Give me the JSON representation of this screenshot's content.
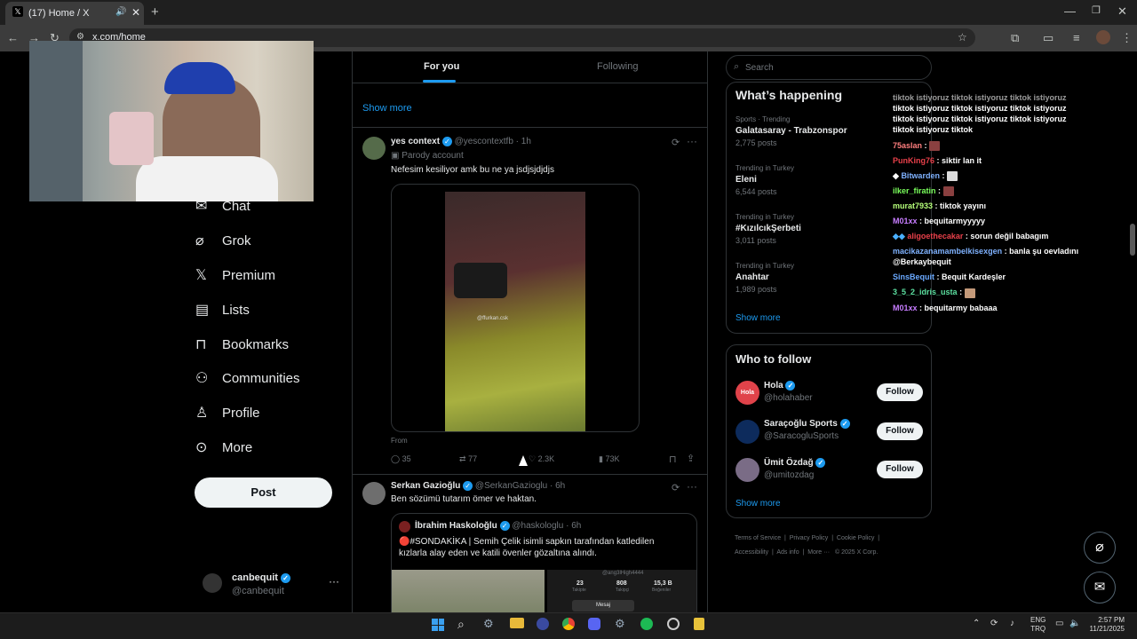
{
  "browser": {
    "tab_title": "(17) Home / X",
    "url": "x.com/home"
  },
  "nav": {
    "items": [
      {
        "label": "Chat",
        "icon": "chat-icon"
      },
      {
        "label": "Grok",
        "icon": "grok-icon"
      },
      {
        "label": "Premium",
        "icon": "x-logo-icon"
      },
      {
        "label": "Lists",
        "icon": "list-icon"
      },
      {
        "label": "Bookmarks",
        "icon": "bookmark-icon"
      },
      {
        "label": "Communities",
        "icon": "communities-icon"
      },
      {
        "label": "Profile",
        "icon": "profile-icon"
      },
      {
        "label": "More",
        "icon": "more-circle-icon"
      }
    ],
    "post_label": "Post",
    "account_name": "canbequit",
    "account_handle": "@canbequit"
  },
  "feed": {
    "tabs": [
      "For you",
      "Following"
    ],
    "show_more": "Show more",
    "post1": {
      "name": "yes context",
      "handle": "@yescontextfb",
      "time": "· 1h",
      "parody": "Parody account",
      "text": "Nefesim kesiliyor amk bu ne ya jsdjsjdjdjs",
      "watermark": "@ffurkan.csk",
      "from": "From",
      "replies": "35",
      "reposts": "77",
      "likes": "2.3K",
      "views": "73K"
    },
    "post2": {
      "name": "Serkan Gazioğlu",
      "handle": "@SerkanGazioglu",
      "time": "· 6h",
      "text": "Ben sözümü tutarım ömer ve haktan.",
      "quote": {
        "name": "İbrahim Haskoloğlu",
        "handle": "@haskologlu",
        "time": "· 6h",
        "text": "🔴#SONDAKİKA | Semih Çelik isimli sapkın tarafından katledilen kızlarla alay eden ve katili övenler gözaltına alındı.",
        "profile_handle": "@ang3lHigh4444",
        "stat1_val": "23",
        "stat1_label": "Takipte",
        "stat2_val": "808",
        "stat2_label": "Takipçi",
        "stat3_val": "15,3 B",
        "stat3_label": "Beğeniler",
        "btn_label": "Mesaj"
      }
    }
  },
  "search": {
    "placeholder": "Search"
  },
  "trends": {
    "title": "What’s happening",
    "items": [
      {
        "context": "Sports · Trending",
        "name": "Galatasaray - Trabzonspor",
        "count": "2,775 posts"
      },
      {
        "context": "Trending in Turkey",
        "name": "Eleni",
        "count": "6,544 posts"
      },
      {
        "context": "Trending in Turkey",
        "name": "#KızılcıkŞerbeti",
        "count": "3,011 posts"
      },
      {
        "context": "Trending in Turkey",
        "name": "Anahtar",
        "count": "1,989 posts"
      }
    ],
    "show_more": "Show more"
  },
  "who_to_follow": {
    "title": "Who to follow",
    "items": [
      {
        "name": "Hola",
        "handle": "@holahaber",
        "avatar_text": "Hola",
        "avatar_color": "#e0434a"
      },
      {
        "name": "Saraçoğlu Sports",
        "handle": "@SaracogluSports",
        "avatar_text": "",
        "avatar_color": "#0d2b5c"
      },
      {
        "name": "Ümit Özdağ",
        "handle": "@umitozdag",
        "avatar_text": "",
        "avatar_color": "#7a6c86"
      }
    ],
    "follow_label": "Follow",
    "show_more": "Show more"
  },
  "footer": {
    "row1": [
      "Terms of Service",
      "Privacy Policy",
      "Cookie Policy"
    ],
    "row2": [
      "Accessibility",
      "Ads info",
      "More ···",
      "© 2025 X Corp."
    ]
  },
  "chat": {
    "spam_lines": [
      "tiktok istiyoruz tiktok istiyoruz tiktok istiyoruz",
      "tiktok istiyoruz tiktok istiyoruz tiktok istiyoruz",
      "tiktok istiyoruz tiktok istiyoruz tiktok istiyoruz",
      "tiktok istiyoruz tiktok"
    ],
    "messages": [
      {
        "user": "75aslan",
        "color": "#ff7f7f",
        "text": ""
      },
      {
        "user": "PunKing76",
        "color": "#e8404a",
        "text": "siktir lan it"
      },
      {
        "user": "Bitwarden",
        "color": "#7fb2ff",
        "text": ""
      },
      {
        "user": "ilker_firatin",
        "color": "#7aff5c",
        "text": ""
      },
      {
        "user": "murat7933",
        "color": "#b6ff7a",
        "text": "tiktok yayını"
      },
      {
        "user": "M01xx",
        "color": "#c77dff",
        "text": "bequitarmyyyyy"
      },
      {
        "user": "aligoethecakar",
        "color": "#e8404a",
        "text": "sorun değil babagım"
      },
      {
        "user": "macikazanamambelkisexgen",
        "color": "#7fb2ff",
        "text": "banla şu oevladını @Berkaybequit"
      },
      {
        "user": "SinsBequit",
        "color": "#6aa9ff",
        "text": "Bequit Kardeşler"
      },
      {
        "user": "3_5_2_idris_usta",
        "color": "#5ce0a0",
        "text": ""
      },
      {
        "user": "M01xx",
        "color": "#c77dff",
        "text": "bequitarmy babaaa"
      }
    ]
  },
  "taskbar": {
    "lang1": "ENG",
    "lang2": "TRQ",
    "time": "2:57 PM",
    "date": "11/21/2025"
  }
}
